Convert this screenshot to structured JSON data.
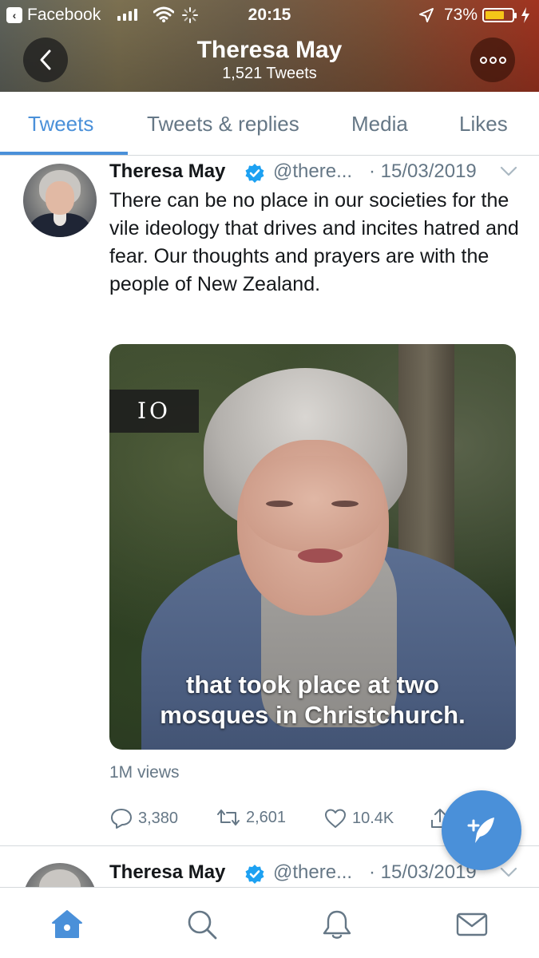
{
  "status_bar": {
    "back_app_label": "Facebook",
    "time": "20:15",
    "battery_percent": "73%",
    "battery_level": 0.73,
    "battery_color": "#f5c518"
  },
  "profile": {
    "name": "Theresa May",
    "tweet_count": "1,521 Tweets"
  },
  "tabs": [
    {
      "label": "Tweets",
      "active": true
    },
    {
      "label": "Tweets & replies",
      "active": false
    },
    {
      "label": "Media",
      "active": false
    },
    {
      "label": "Likes",
      "active": false
    }
  ],
  "tweet": {
    "name": "Theresa May",
    "handle": "@there...",
    "date": "· 15/03/2019",
    "text": "There can be no place in our societies for the vile ideology that drives and incites hatred and fear. Our thoughts and prayers are with the people of New Zealand.",
    "media": {
      "counter": "IO",
      "caption_line1": "that took place at two",
      "caption_line2": "mosques in Christchurch."
    },
    "views": "1M views",
    "actions": {
      "replies": "3,380",
      "retweets": "2,601",
      "likes": "10.4K"
    }
  },
  "tweet2": {
    "name": "Theresa May",
    "handle": "@there...",
    "date": "· 15/03/2019"
  },
  "bottom_nav": [
    "home-icon",
    "search-icon",
    "bell-icon",
    "mail-icon"
  ],
  "colors": {
    "accent": "#4a90d9",
    "verified": "#1da1f2",
    "secondary_text": "#657786"
  }
}
